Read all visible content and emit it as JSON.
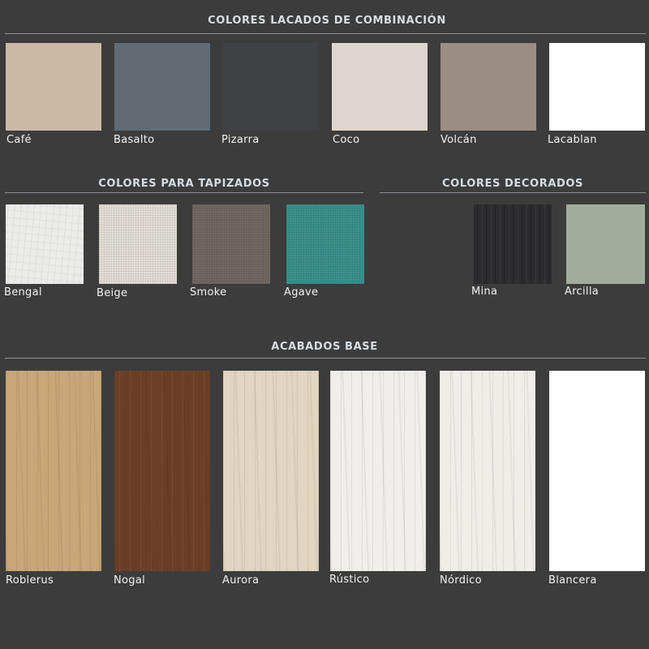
{
  "sections": {
    "lacados": {
      "title": "COLORES LACADOS DE COMBINACIÓN",
      "swatches": [
        {
          "name": "Café",
          "color": "#cbb9a6"
        },
        {
          "name": "Basalto",
          "color": "#626b73"
        },
        {
          "name": "Pizarra",
          "color": "#404144"
        },
        {
          "name": "Coco",
          "color": "#dcd6cf"
        },
        {
          "name": "Volcán",
          "color": "#9c8d83"
        },
        {
          "name": "Lacablan",
          "color": "#ffffff"
        }
      ]
    },
    "tapizados": {
      "title": "COLORES PARA TAPIZADOS",
      "swatches": [
        {
          "name": "Bengal",
          "color": "#ebebe9"
        },
        {
          "name": "Beige",
          "color": "#e2ded6"
        },
        {
          "name": "Smoke",
          "color": "#716862"
        },
        {
          "name": "Agave",
          "color": "#3a918e"
        }
      ]
    },
    "decorados": {
      "title": "COLORES DECORADOS",
      "swatches": [
        {
          "name": "Mina",
          "color": "#2c2c2e"
        },
        {
          "name": "Arcilla",
          "color": "#a0ad9c"
        }
      ]
    },
    "base": {
      "title": "ACABADOS BASE",
      "swatches": [
        {
          "name": "Roblerus",
          "color": "#c8a675"
        },
        {
          "name": "Nogal",
          "color": "#6b3f27"
        },
        {
          "name": "Aurora",
          "color": "#e0d6c0"
        },
        {
          "name": "Rústico",
          "color": "#efeeea"
        },
        {
          "name": "Nórdico",
          "color": "#eeede8"
        },
        {
          "name": "Blancera",
          "color": "#ffffff"
        }
      ]
    }
  }
}
